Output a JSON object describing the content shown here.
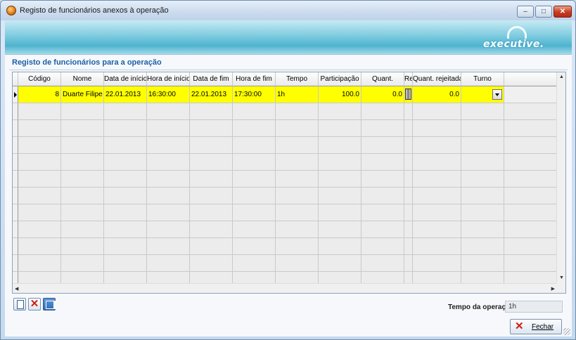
{
  "window": {
    "title": "Registo de funcionários anexos à operação",
    "controls": {
      "minimize": "–",
      "maximize": "□",
      "close": "✕"
    }
  },
  "banner": {
    "logo_text": "executive."
  },
  "section": {
    "title": "Registo de funcionários para a operação"
  },
  "grid": {
    "columns": [
      "Código",
      "Nome",
      "Data de início",
      "Hora de início",
      "Data de fim",
      "Hora de fim",
      "Tempo",
      "Participação",
      "Quant.",
      "Rej",
      "Quant. rejeitada",
      "Turno"
    ],
    "rows": [
      {
        "codigo": "8",
        "nome": "Duarte Filipe Ra",
        "data_inicio": "22.01.2013",
        "hora_inicio": "16:30:00",
        "data_fim": "22.01.2013",
        "hora_fim": "17:30:00",
        "tempo": "1h",
        "participacao": "100.0",
        "quant": "0.0",
        "rej": "",
        "quant_rejeitada": "0.0",
        "turno": ""
      }
    ],
    "selected_row_color": "#ffff00"
  },
  "toolbar": {
    "new_icon": "new-document-icon",
    "delete_icon": "delete-x-icon",
    "properties_icon": "properties-icon"
  },
  "footer": {
    "operation_time_label": "Tempo da operação:",
    "operation_time_value": "1h",
    "close_label": "Fechar"
  }
}
